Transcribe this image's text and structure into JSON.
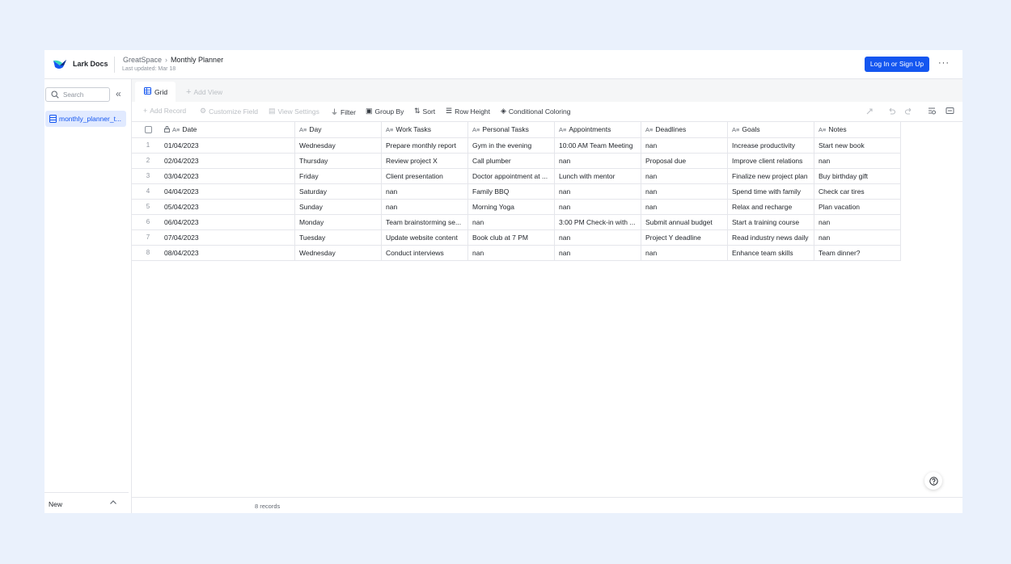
{
  "header": {
    "app_name": "Lark Docs",
    "breadcrumb": [
      "GreatSpace",
      "Monthly Planner"
    ],
    "last_updated": "Last updated: Mar 18",
    "login_label": "Log In or Sign Up",
    "more_label": "···",
    "accent_color": "#1456f0"
  },
  "sidebar": {
    "search_placeholder": "Search",
    "items": [
      {
        "label": "monthly_planner_t..."
      }
    ],
    "footer_label": "New"
  },
  "view_tabs": {
    "active": "Grid",
    "add_view": "Add View"
  },
  "toolbar": {
    "add_record": "Add Record",
    "customize_field": "Customize Field",
    "view_settings": "View Settings",
    "filter": "Filter",
    "group_by": "Group By",
    "sort": "Sort",
    "row_height": "Row Height",
    "conditional_coloring": "Conditional Coloring"
  },
  "table": {
    "columns": [
      "Date",
      "Day",
      "Work Tasks",
      "Personal Tasks",
      "Appointments",
      "Deadlines",
      "Goals",
      "Notes"
    ],
    "rows": [
      {
        "n": "1",
        "date": "01/04/2023",
        "day": "Wednesday",
        "work": "Prepare monthly report",
        "personal": "Gym in the evening",
        "appt": "10:00 AM Team Meeting",
        "deadline": "nan",
        "goal": "Increase productivity",
        "note": "Start new book"
      },
      {
        "n": "2",
        "date": "02/04/2023",
        "day": "Thursday",
        "work": "Review project X",
        "personal": "Call plumber",
        "appt": "nan",
        "deadline": "Proposal due",
        "goal": "Improve client relations",
        "note": "nan"
      },
      {
        "n": "3",
        "date": "03/04/2023",
        "day": "Friday",
        "work": "Client presentation",
        "personal": "Doctor appointment at ...",
        "appt": "Lunch with mentor",
        "deadline": "nan",
        "goal": "Finalize new project plan",
        "note": "Buy birthday gift"
      },
      {
        "n": "4",
        "date": "04/04/2023",
        "day": "Saturday",
        "work": "nan",
        "personal": "Family BBQ",
        "appt": "nan",
        "deadline": "nan",
        "goal": "Spend time with family",
        "note": "Check car tires"
      },
      {
        "n": "5",
        "date": "05/04/2023",
        "day": "Sunday",
        "work": "nan",
        "personal": "Morning Yoga",
        "appt": "nan",
        "deadline": "nan",
        "goal": "Relax and recharge",
        "note": "Plan vacation"
      },
      {
        "n": "6",
        "date": "06/04/2023",
        "day": "Monday",
        "work": "Team brainstorming se...",
        "personal": "nan",
        "appt": "3:00 PM Check-in with ...",
        "deadline": "Submit annual budget",
        "goal": "Start a training course",
        "note": "nan"
      },
      {
        "n": "7",
        "date": "07/04/2023",
        "day": "Tuesday",
        "work": "Update website content",
        "personal": "Book club at 7 PM",
        "appt": "nan",
        "deadline": "Project Y deadline",
        "goal": "Read industry news daily",
        "note": "nan"
      },
      {
        "n": "8",
        "date": "08/04/2023",
        "day": "Wednesday",
        "work": "Conduct interviews",
        "personal": "nan",
        "appt": "nan",
        "deadline": "nan",
        "goal": "Enhance team skills",
        "note": "Team dinner?"
      }
    ]
  },
  "status": {
    "record_count": "8 records"
  }
}
